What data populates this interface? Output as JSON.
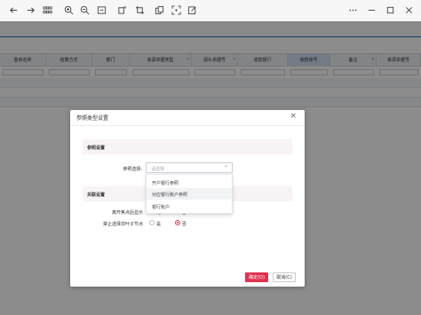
{
  "toolbar": {
    "icons": [
      "back-icon",
      "forward-icon",
      "grid-icon",
      "zoom-in-icon",
      "zoom-out-icon",
      "fit-page-icon",
      "rotate-icon",
      "crop-icon",
      "copy-icon",
      "expand-icon",
      "edit-icon",
      "more-icon",
      "minimize-icon",
      "maximize-icon",
      "close-icon"
    ]
  },
  "table": {
    "columns": [
      "客商名称",
      "结算方式",
      "部门",
      "来源单据类型",
      "源头单据号",
      "收款银行",
      "收款账号",
      "备注",
      "来源单据号"
    ]
  },
  "modal": {
    "title": "参照类型设置",
    "close": "×",
    "section_basic": "参照设置",
    "ref_select_label": "参照选择:",
    "ref_select_placeholder": "请选择",
    "dropdown_options": [
      "开户银行参照",
      "对应银行账户参照",
      "银行账户"
    ],
    "section_link": "关联设置",
    "auto_display_label": "离开焦点后显示",
    "auto_display_yes": "是",
    "auto_display_no": "否",
    "forbid_select_label": "禁止选择非叶子节点",
    "forbid_select_yes": "是",
    "forbid_select_no": "否",
    "ok_button": "确定(O)",
    "cancel_button": "取消(C)"
  },
  "colors": {
    "accent": "#e0334f",
    "header_active": "#cfe0f4",
    "blue_line": "#3b6fc9"
  }
}
